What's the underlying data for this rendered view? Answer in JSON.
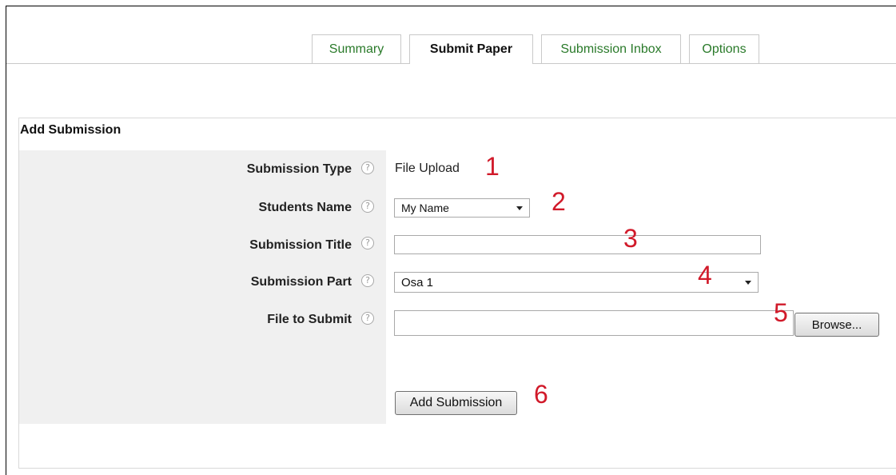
{
  "tabs": [
    {
      "label": "Summary",
      "active": false
    },
    {
      "label": "Submit Paper",
      "active": true
    },
    {
      "label": "Submission Inbox",
      "active": false
    },
    {
      "label": "Options",
      "active": false
    }
  ],
  "section_title": "Add Submission",
  "fields": {
    "submission_type": {
      "label": "Submission Type",
      "value": "File Upload"
    },
    "students_name": {
      "label": "Students Name",
      "selected": "My Name"
    },
    "submission_title": {
      "label": "Submission Title",
      "value": ""
    },
    "submission_part": {
      "label": "Submission Part",
      "selected": "Osa 1"
    },
    "file_to_submit": {
      "label": "File to Submit",
      "value": "",
      "browse_label": "Browse..."
    }
  },
  "help_glyph": "?",
  "submit_button": "Add Submission",
  "markers": [
    "1",
    "2",
    "3",
    "4",
    "5",
    "6"
  ],
  "colors": {
    "tab_link": "#2a7a2a",
    "marker": "#d11a2a",
    "label_bg": "#f0f0f0"
  }
}
